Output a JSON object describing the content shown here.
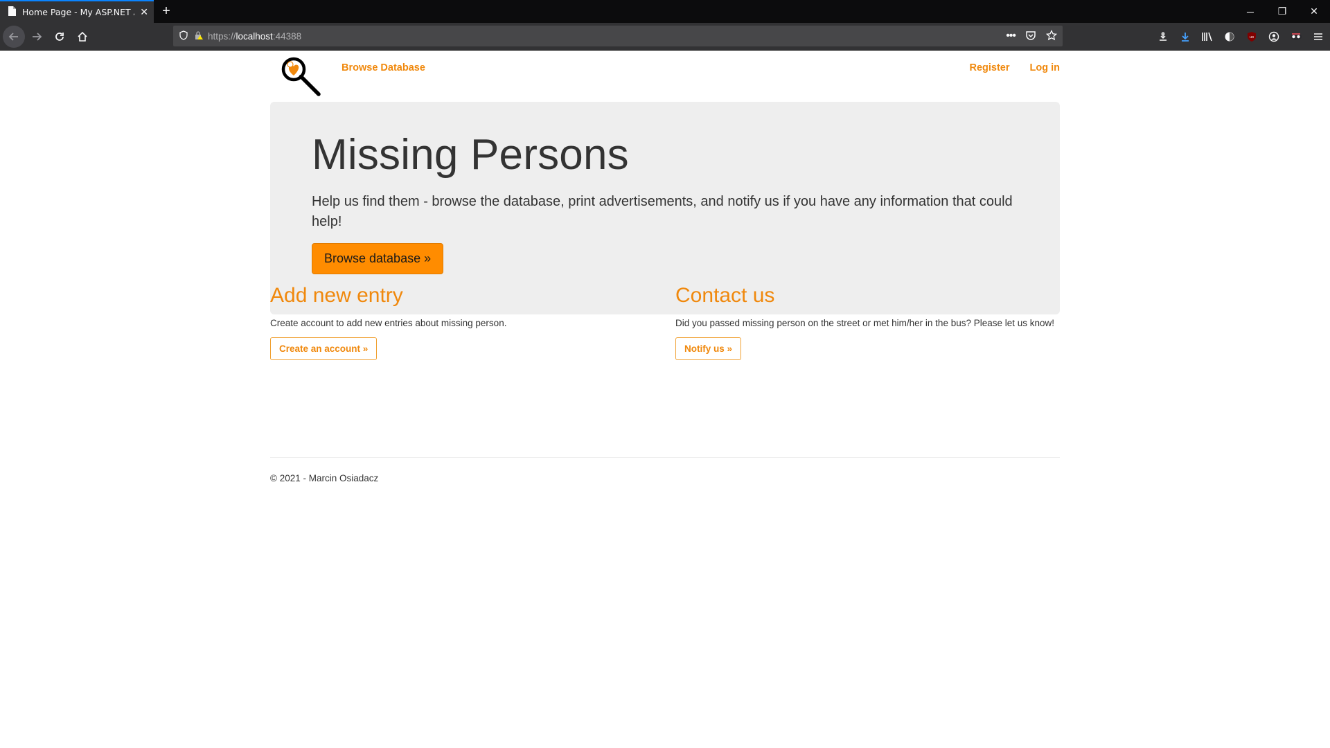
{
  "browser": {
    "tab_title": "Home Page - My ASP.NET Appl",
    "url_proto": "https://",
    "url_host": "localhost",
    "url_port": ":44388"
  },
  "header": {
    "nav_link": "Browse Database",
    "register": "Register",
    "login": "Log in"
  },
  "hero": {
    "title": "Missing Persons",
    "lead": "Help us find them - browse the database, print advertisements, and notify us if you have any information that could help!",
    "button": "Browse database »"
  },
  "columns": [
    {
      "heading": "Add new entry",
      "text": "Create account to add new entries about missing person.",
      "button": "Create an account »"
    },
    {
      "heading": "Contact us",
      "text": "Did you passed missing person on the street or met him/her in the bus? Please let us know!",
      "button": "Notify us »"
    }
  ],
  "footer": {
    "text": "© 2021 - Marcin Osiadacz"
  },
  "colors": {
    "accent": "#f0880c",
    "button_bg": "#ff8c00",
    "jumbotron_bg": "#eeeeee"
  }
}
